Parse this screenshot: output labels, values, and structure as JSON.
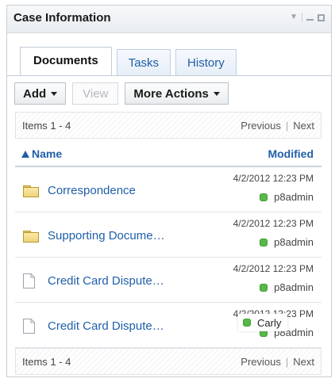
{
  "panel": {
    "title": "Case Information"
  },
  "tabs": [
    {
      "label": "Documents",
      "active": true
    },
    {
      "label": "Tasks",
      "active": false
    },
    {
      "label": "History",
      "active": false
    }
  ],
  "toolbar": {
    "add_label": "Add",
    "view_label": "View",
    "more_actions_label": "More Actions"
  },
  "pager_top": {
    "count": "Items 1 - 4",
    "previous": "Previous",
    "separator": "|",
    "next": "Next"
  },
  "pager_bottom": {
    "count": "Items 1 - 4",
    "previous": "Previous",
    "separator": "|",
    "next": "Next"
  },
  "columns": {
    "name": "Name",
    "modified": "Modified"
  },
  "rows": [
    {
      "type": "folder",
      "name": "Correspondence",
      "date": "4/2/2012 12:23 PM",
      "user": "p8admin"
    },
    {
      "type": "folder",
      "name": "Supporting Docume…",
      "date": "4/2/2012 12:23 PM",
      "user": "p8admin"
    },
    {
      "type": "document",
      "name": "Credit Card Dispute…",
      "date": "4/2/2012 12:23 PM",
      "user": "p8admin"
    },
    {
      "type": "document",
      "name": "Credit Card Dispute…",
      "date": "4/2/2012 12:23 PM",
      "user": "p8admin"
    }
  ],
  "hover_tooltip": {
    "user": "Carly"
  },
  "colors": {
    "link": "#1f5fa8",
    "presence": "#58b84a",
    "folder": "#efd37b"
  }
}
